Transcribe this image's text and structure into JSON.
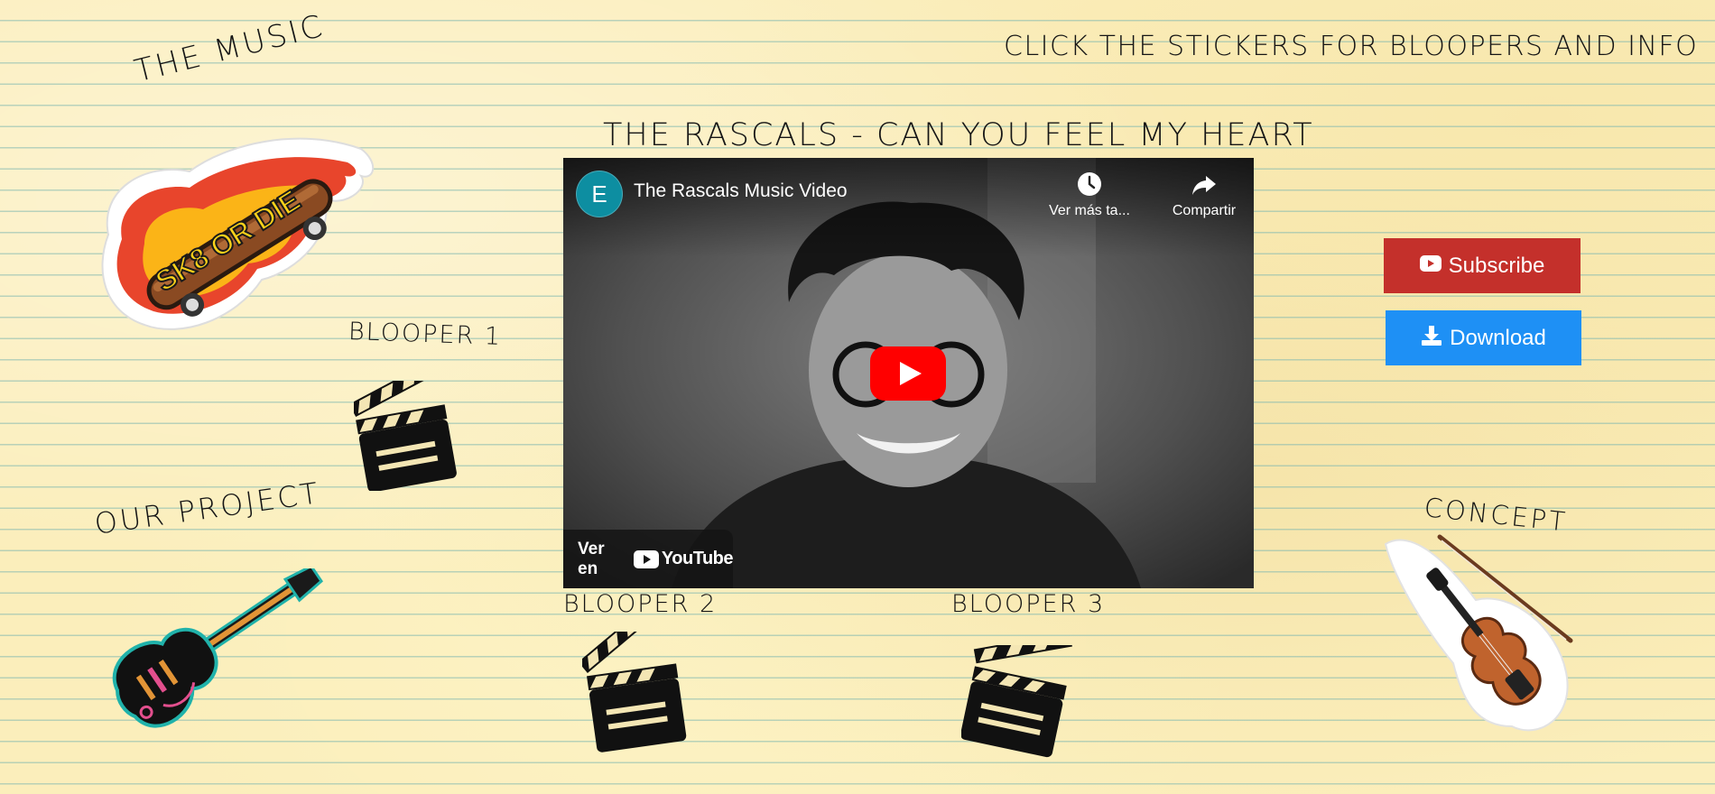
{
  "nav": {
    "music": "THE MUSIC",
    "project": "OUR PROJECT",
    "concept": "CONCEPT"
  },
  "header": {
    "instructions": "CLICK THE STICKERS FOR BLOOPERS AND INFO",
    "song_title": "THE RASCALS - CAN YOU FEEL MY HEART"
  },
  "stickers": {
    "skate_text": "SK8 OR DIE",
    "blooper1": "BLOOPER 1",
    "blooper2": "BLOOPER 2",
    "blooper3": "BLOOPER 3"
  },
  "video": {
    "channel_initial": "E",
    "title": "The Rascals Music Video",
    "watch_later": "Ver más ta...",
    "share": "Compartir",
    "watch_on": "Ver en",
    "youtube_wordmark": "YouTube"
  },
  "buttons": {
    "subscribe": "Subscribe",
    "download": "Download"
  },
  "colors": {
    "paper": "#fbeebb",
    "rule_lines": "#80b8b0",
    "subscribe": "#c4302b",
    "download": "#1e90f5",
    "youtube_red": "#ff0000",
    "channel_avatar": "#0d8ea1"
  },
  "icons": {
    "watch_later": "clock-icon",
    "share": "share-arrow-icon",
    "play": "youtube-play-icon",
    "subscribe": "youtube-icon",
    "download": "download-icon"
  }
}
